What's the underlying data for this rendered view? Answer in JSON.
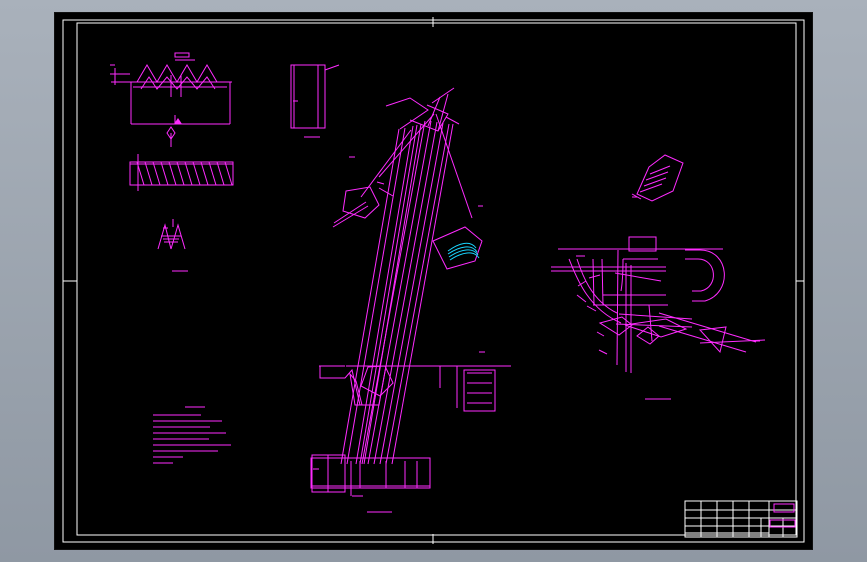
{
  "sheet": {
    "background": "#000000",
    "frame_color": "#ffffff",
    "line_color": "#ff2bff",
    "accent_color": "#19d5ff"
  },
  "views": {
    "rack_section": {
      "label": ""
    },
    "helix_view": {
      "label": ""
    },
    "main_assembly": {
      "label": ""
    },
    "top_right_view": {
      "label": ""
    }
  },
  "notes": {
    "title": "",
    "lines": []
  },
  "title_block": {
    "cells": []
  }
}
